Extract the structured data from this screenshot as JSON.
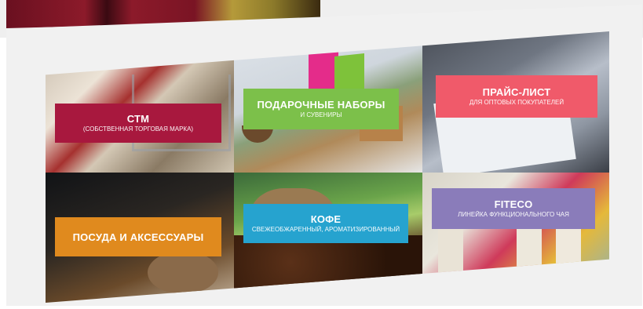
{
  "tiles": [
    {
      "title": "СТМ",
      "subtitle": "(СОБСТВЕННАЯ ТОРГОВАЯ МАРКА)",
      "color": "#a8183e"
    },
    {
      "title": "ПОДАРОЧНЫЕ НАБОРЫ",
      "subtitle": "И СУВЕНИРЫ",
      "color": "#7cc04a"
    },
    {
      "title": "ПРАЙС-ЛИСТ",
      "subtitle": "ДЛЯ ОПТОВЫХ ПОКУПАТЕЛЕЙ",
      "color": "#f05a6a"
    },
    {
      "title": "ПОСУДА И АКСЕССУАРЫ",
      "subtitle": "",
      "color": "#e08a1e"
    },
    {
      "title": "КОФЕ",
      "subtitle": "СВЕЖЕОБЖАРЕННЫЙ, АРОМАТИЗИРОВАННЫЙ",
      "color": "#26a3cf"
    },
    {
      "title": "FITECO",
      "subtitle": "ЛИНЕЙКА ФУНКЦИОНАЛЬНОГО ЧАЯ",
      "color": "#8a7cba"
    }
  ]
}
